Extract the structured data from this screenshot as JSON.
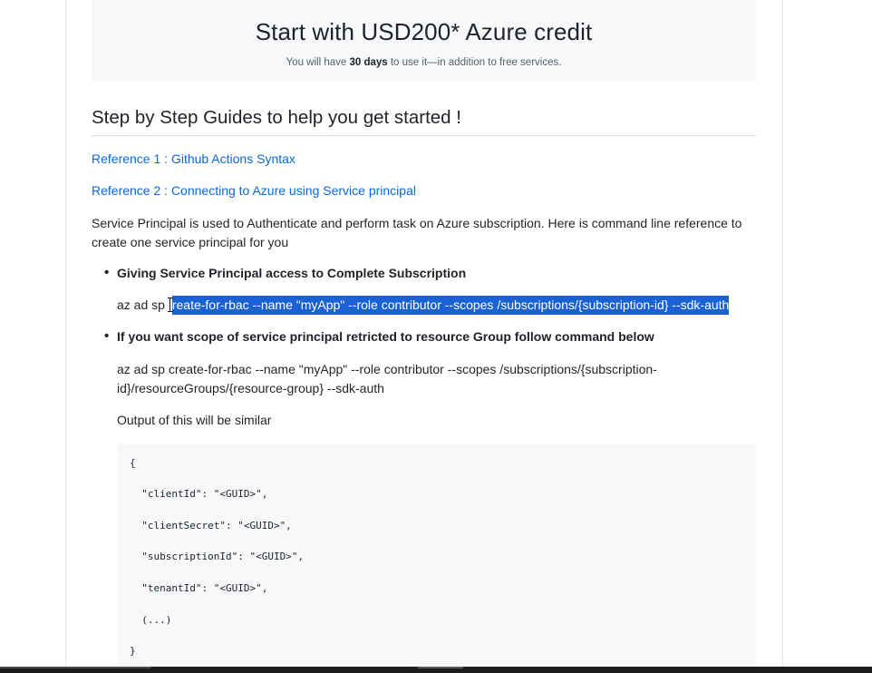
{
  "banner": {
    "title": "Start with USD200* Azure credit",
    "subtitle_pre": "You will have ",
    "subtitle_bold": "30 days",
    "subtitle_post": " to use it—in addition to free services."
  },
  "guides": {
    "heading": "Step by Step Guides to help you get started !",
    "reference1": "Reference 1 : Github Actions Syntax",
    "reference2": "Reference 2 : Connecting to Azure using Service principal",
    "intro": "Service Principal is used to Authenticate and perform task on Azure subscription. Here is command line reference to create one service principal for you",
    "bullet1": "Giving Service Principal access to Complete Subscription",
    "cmd1_prefix": "az ad sp ",
    "cmd1_selected": "reate-for-rbac --name \"myApp\" --role contributor --scopes /subscriptions/{subscription-id} --sdk-auth",
    "bullet2": "If you want scope of service principal retricted to resource Group follow command below",
    "cmd2": "az ad sp create-for-rbac --name \"myApp\" --role contributor --scopes /subscriptions/{subscription-id}/resourceGroups/{resource-group} --sdk-auth",
    "output_label": "Output of this will be similar"
  },
  "code": {
    "lines": [
      "{",
      "  \"clientId\": \"<GUID>\",",
      "  \"clientSecret\": \"<GUID>\",",
      "  \"subscriptionId\": \"<GUID>\",",
      "  \"tenantId\": \"<GUID>\",",
      "  (...)",
      "}"
    ]
  }
}
